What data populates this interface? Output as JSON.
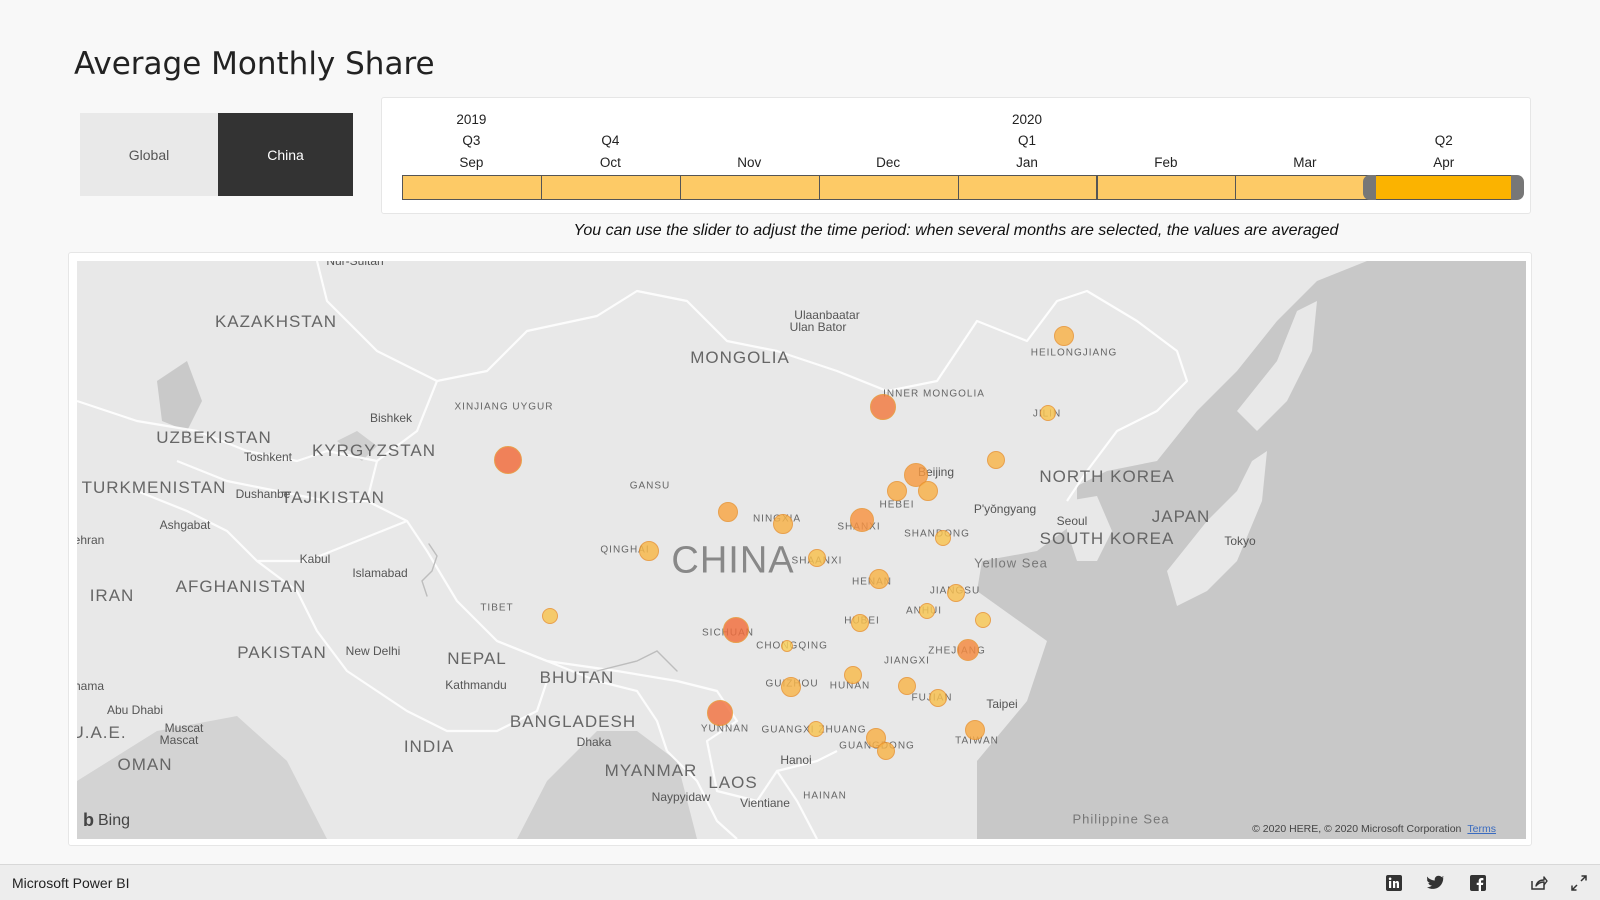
{
  "title": "Average Monthly Share",
  "region_toggle": {
    "global_label": "Global",
    "china_label": "China",
    "selected": "China"
  },
  "slicer": {
    "years": [
      {
        "label": "2019",
        "col": 0
      },
      {
        "label": "2020",
        "col": 4
      }
    ],
    "quarters": [
      {
        "label": "Q3",
        "col": 0
      },
      {
        "label": "Q4",
        "col": 1
      },
      {
        "label": "Q1",
        "col": 4
      },
      {
        "label": "Q2",
        "col": 7
      }
    ],
    "months": [
      "Sep",
      "Oct",
      "Nov",
      "Dec",
      "Jan",
      "Feb",
      "Mar",
      "Apr"
    ],
    "selected_months": [
      "Apr"
    ]
  },
  "hint": "You can use the slider to adjust the time period: when several months are selected, the values are averaged",
  "map": {
    "provider": "Bing",
    "copyright": "© 2020 HERE, © 2020 Microsoft Corporation",
    "terms_label": "Terms",
    "labels": {
      "countries": [
        "KAZAKHSTAN",
        "MONGOLIA",
        "UZBEKISTAN",
        "KYRGYZSTAN",
        "TURKMENISTAN",
        "TAJIKISTAN",
        "AFGHANISTAN",
        "IRAN",
        "PAKISTAN",
        "NEPAL",
        "BHUTAN",
        "BANGLADESH",
        "INDIA",
        "MYANMAR",
        "LAOS",
        "NORTH KOREA",
        "SOUTH KOREA",
        "JAPAN",
        "U.A.E.",
        "OMAN"
      ],
      "china": "CHINA",
      "provinces": [
        "XINJIANG UYGUR",
        "INNER MONGOLIA",
        "HEILONGJIANG",
        "JILIN",
        "GANSU",
        "QINGHAI",
        "NINGXIA",
        "SHANXI",
        "SHAANXI",
        "HEBEI",
        "SHANDONG",
        "HENAN",
        "JIANGSU",
        "ANHUI",
        "HUBEI",
        "SICHUAN",
        "CHONGQING",
        "ZHEJIANG",
        "JIANGXI",
        "HUNAN",
        "GUIZHOU",
        "FUJIAN",
        "YUNNAN",
        "GUANGXI ZHUANG",
        "GUANGDONG",
        "TAIWAN",
        "TIBET",
        "HAINAN"
      ],
      "cities": [
        "Nur-Sultan",
        "Ulaanbaatar",
        "Ulan Bator",
        "Bishkek",
        "Toshkent",
        "Dushanbe",
        "Ashgabat",
        "Kabul",
        "Islamabad",
        "New Delhi",
        "Kathmandu",
        "Dhaka",
        "Abu Dhabi",
        "Muscat",
        "Mascat",
        "Beijing",
        "P'yŏngyang",
        "Seoul",
        "Tokyo",
        "Taipei",
        "Hanoi",
        "Naypyidaw",
        "Vientiane",
        "ehran",
        "hama"
      ],
      "seas": [
        "Yellow Sea",
        "Philippine Sea"
      ]
    }
  },
  "footer": {
    "brand": "Microsoft Power BI",
    "icons": [
      "linkedin-icon",
      "twitter-icon",
      "facebook-icon",
      "share-icon",
      "expand-icon"
    ]
  }
}
